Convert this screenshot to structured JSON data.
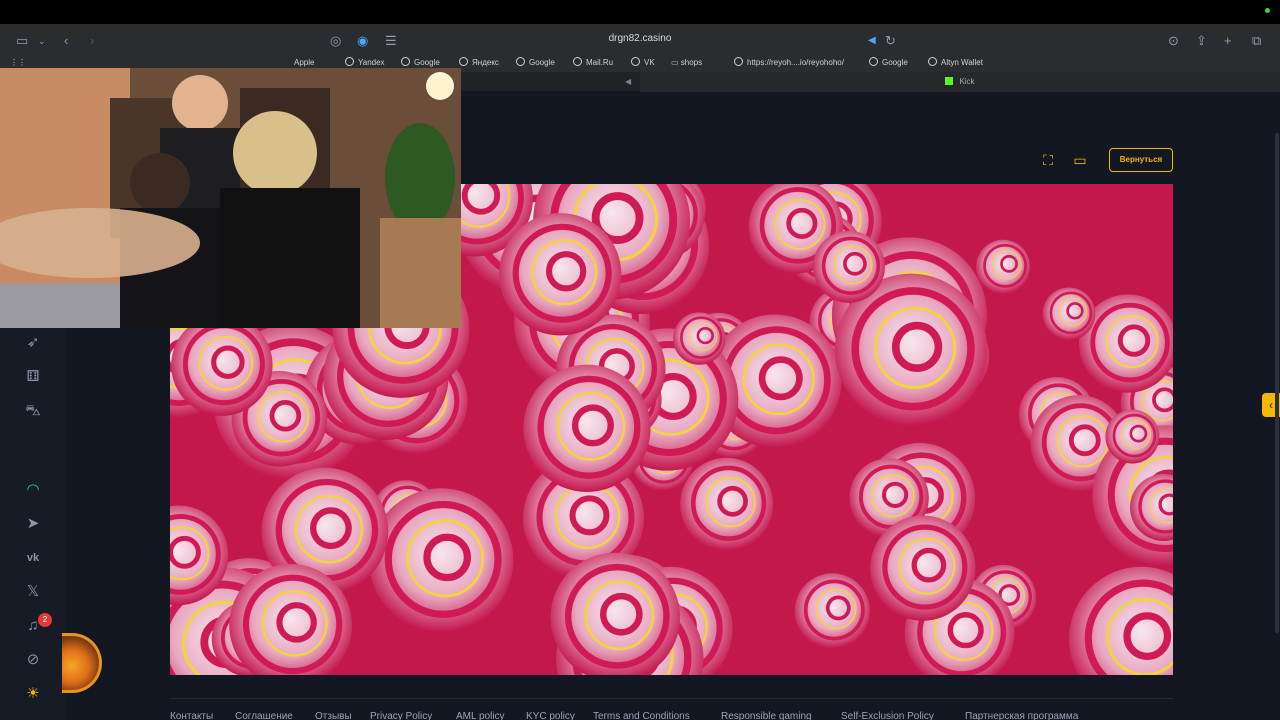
{
  "browser": {
    "url": "drgn82.casino",
    "bookmarks": [
      "Apple",
      "Yandex",
      "Google",
      "Яндекс",
      "Google",
      "Mail.Ru",
      "VK",
      "shops",
      "https://reyoh....io/reyohoho/",
      "Google",
      "Altyn Wallet"
    ],
    "tab_right": "Kick"
  },
  "game_header": {
    "back_label": "Вернуться"
  },
  "sidebar": {
    "notification_count": "2",
    "icons": [
      "rocket-icon",
      "dice-icon",
      "bag-icon",
      "support-icon",
      "telegram-icon",
      "vk-icon",
      "x-icon",
      "bell-icon",
      "mute-icon",
      "sun-icon"
    ]
  },
  "footer": {
    "links": [
      "Контакты",
      "Соглашение",
      "Отзывы",
      "Privacy Policy",
      "AML policy",
      "KYC policy",
      "Terms and Conditions",
      "Responsible gaming",
      "Self-Exclusion Policy",
      "Партнерская программа"
    ]
  },
  "colors": {
    "accent": "#f5b700",
    "game_bg": "#c2184b",
    "site_bg": "#131722"
  }
}
